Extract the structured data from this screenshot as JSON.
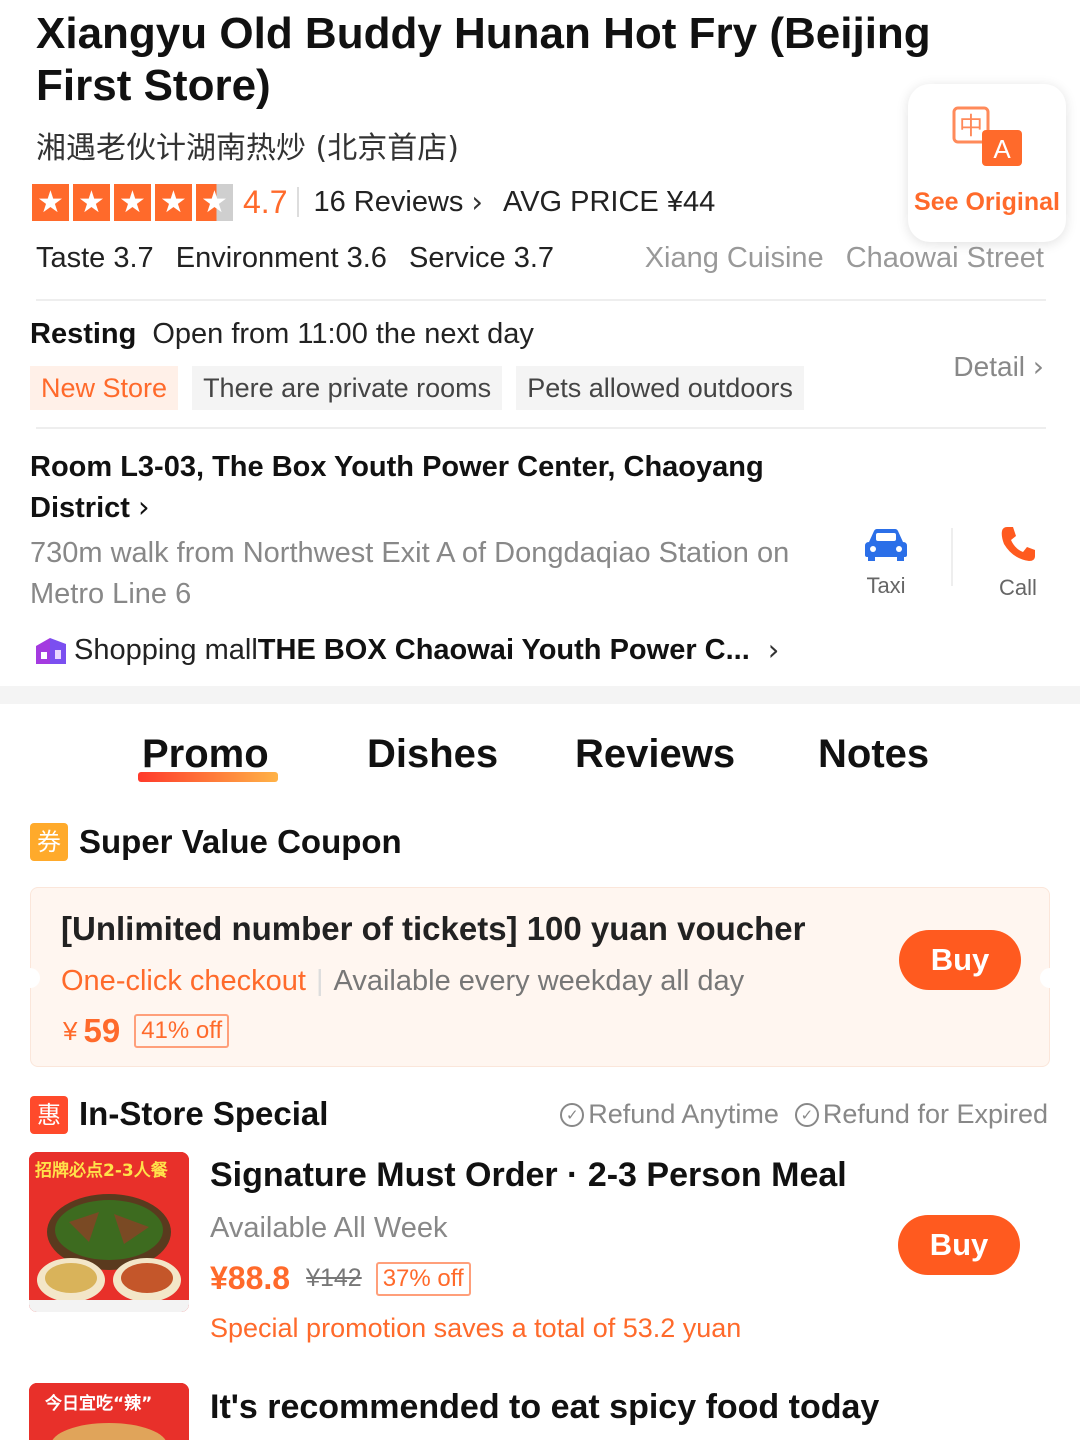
{
  "header": {
    "title": "Xiangyu Old Buddy Hunan Hot Fry (Beijing First Store)",
    "subtitle": "湘遇老伙计湖南热炒 (北京首店)",
    "rating": "4.7",
    "stars": 4.5,
    "reviews_label": "16 Reviews",
    "avg_price": "AVG PRICE ¥44",
    "subscores": [
      "Taste 3.7",
      "Environment 3.6",
      "Service 3.7"
    ],
    "categories": [
      "Xiang Cuisine",
      "Chaowai Street"
    ],
    "see_original_label": "See Original",
    "translate_glyph_zh": "中",
    "translate_glyph_en": "A"
  },
  "hours": {
    "status": "Resting",
    "open_text": "Open from 11:00 the next day",
    "tags": [
      "New Store",
      "There are private rooms",
      "Pets allowed outdoors"
    ],
    "detail_label": "Detail"
  },
  "location": {
    "address": "Room L3-03, The Box Youth Power Center, Chaoyang District",
    "walk": "730m walk from Northwest Exit A of Dongdaqiao Station on Metro Line 6",
    "taxi_label": "Taxi",
    "call_label": "Call",
    "mall_prefix": "Shopping mall",
    "mall_name": "THE BOX Chaowai Youth Power C..."
  },
  "tabs": [
    "Promo",
    "Dishes",
    "Reviews",
    "Notes"
  ],
  "coupon_section": {
    "icon_glyph": "券",
    "title": "Super Value Coupon",
    "coupon": {
      "title": "[Unlimited number of tickets] 100 yuan voucher",
      "checkout": "One-click checkout",
      "separator": "|",
      "availability": "Available every weekday all day",
      "currency": "¥",
      "price": "59",
      "discount": "41% off",
      "buy_label": "Buy"
    }
  },
  "special_section": {
    "icon_glyph": "惠",
    "title": "In-Store Special",
    "guarantees": [
      "Refund Anytime",
      "Refund for Expired"
    ],
    "deals": [
      {
        "title": "Signature Must Order · 2-3 Person Meal",
        "availability": "Available All Week",
        "price": "¥88.8",
        "original_price": "¥142",
        "discount": "37% off",
        "saving": "Special promotion saves a total of 53.2 yuan",
        "buy_label": "Buy",
        "image_caption": "招牌必点2-3人餐"
      },
      {
        "title": "It's recommended to eat spicy food today",
        "image_caption": "今日宜吃“辣”"
      }
    ]
  },
  "colors": {
    "accent": "#ff6a2b",
    "buy_button": "#ff5a1f",
    "coupon_bg": "#fff6f0",
    "muted": "#888888",
    "tag_bg": "#f4f4f4"
  },
  "icons": [
    "star-icon",
    "chevron-right-icon",
    "translate-icon",
    "car-icon",
    "phone-icon",
    "shopping-bag-icon",
    "coupon-icon",
    "discount-icon",
    "check-circle-icon"
  ]
}
